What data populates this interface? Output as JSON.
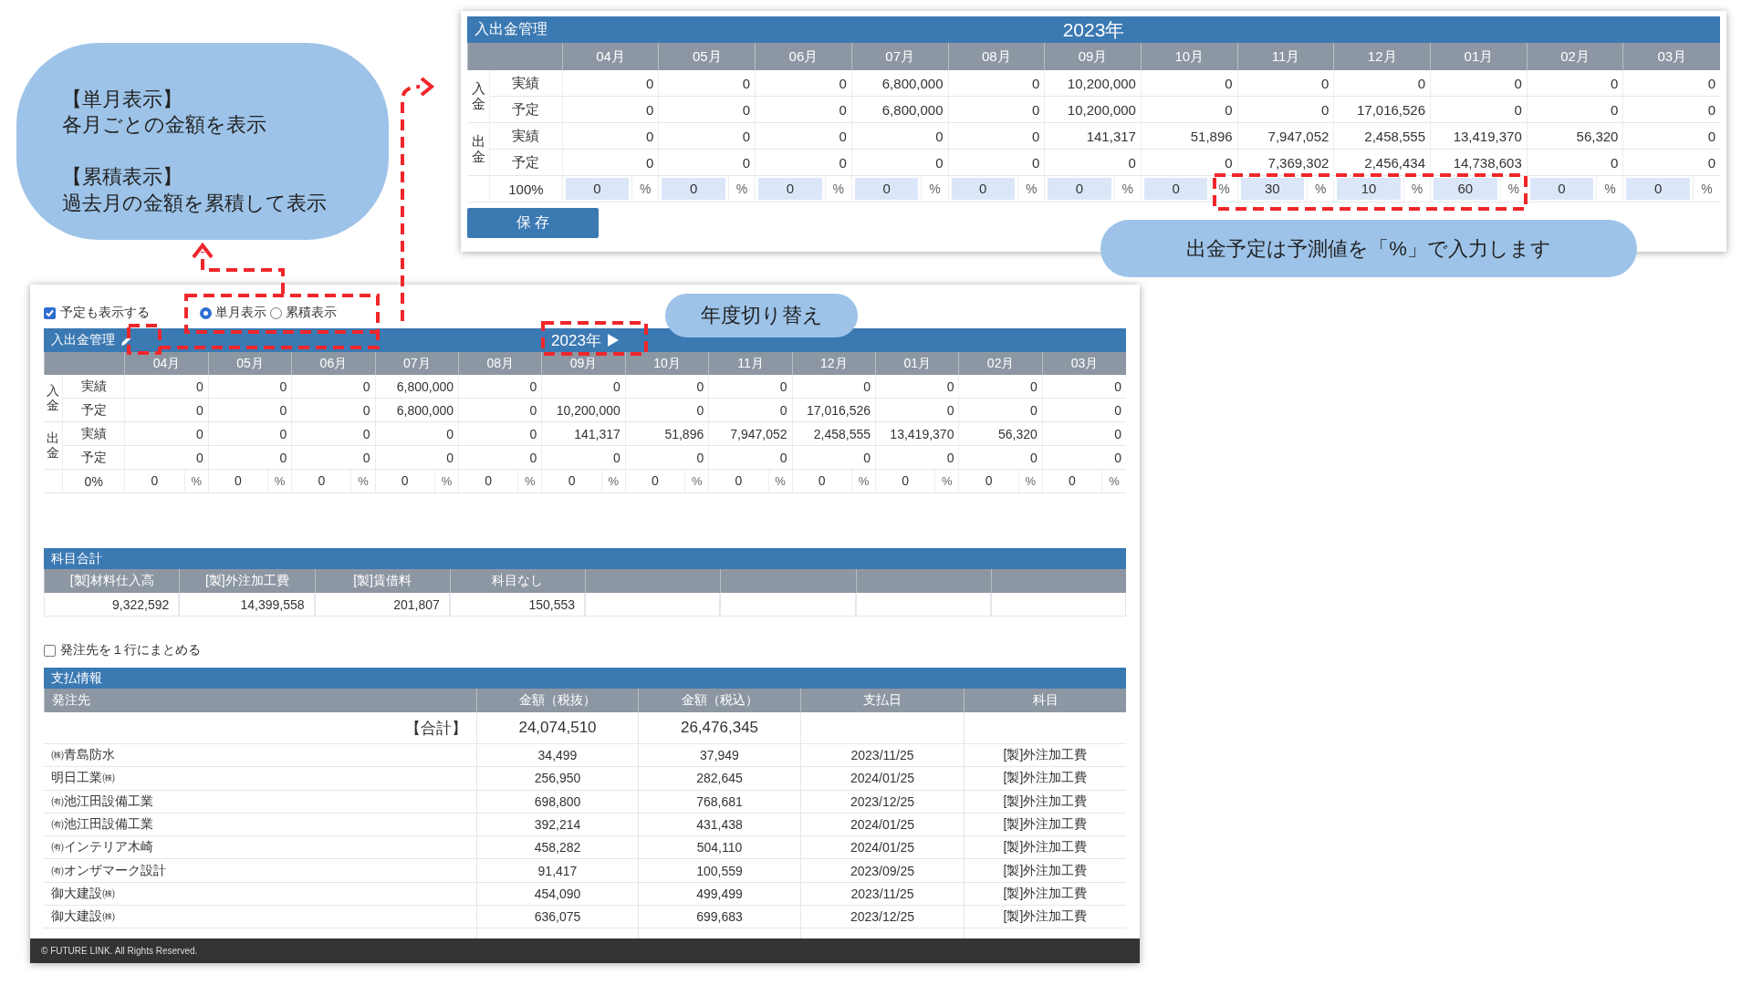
{
  "notes": [
    {
      "kind": "bubble",
      "lines": [
        "【単月表示】",
        "各月ごとの金額を表示",
        "【累積表示】",
        "過去月の金額を累積して表示"
      ]
    },
    {
      "kind": "pill",
      "lines": [
        "出金予定は予測値を「%」で入力します"
      ]
    },
    {
      "kind": "pill",
      "lines": [
        "年度切り替え"
      ]
    }
  ],
  "top_panel": {
    "title": "入出金管理",
    "year": "2023年",
    "months": [
      "04月",
      "05月",
      "06月",
      "07月",
      "08月",
      "09月",
      "10月",
      "11月",
      "12月",
      "01月",
      "02月",
      "03月"
    ],
    "groups": [
      {
        "label": "入金",
        "rows": [
          {
            "label": "実績",
            "values": [
              "0",
              "0",
              "0",
              "6,800,000",
              "0",
              "10,200,000",
              "0",
              "0",
              "0",
              "0",
              "0",
              "0"
            ]
          },
          {
            "label": "予定",
            "values": [
              "0",
              "0",
              "0",
              "6,800,000",
              "0",
              "10,200,000",
              "0",
              "0",
              "17,016,526",
              "0",
              "0",
              "0"
            ]
          }
        ]
      },
      {
        "label": "出金",
        "rows": [
          {
            "label": "実績",
            "values": [
              "0",
              "0",
              "0",
              "0",
              "0",
              "141,317",
              "51,896",
              "7,947,052",
              "2,458,555",
              "13,419,370",
              "56,320",
              "0"
            ]
          },
          {
            "label": "予定",
            "values": [
              "0",
              "0",
              "0",
              "0",
              "0",
              "0",
              "0",
              "7,369,302",
              "2,456,434",
              "14,738,603",
              "0",
              "0"
            ]
          }
        ]
      }
    ],
    "percent_row": {
      "label": "100%",
      "editable": true,
      "cells": [
        {
          "value": "0",
          "unit": "%"
        },
        {
          "value": "0",
          "unit": "%"
        },
        {
          "value": "0",
          "unit": "%"
        },
        {
          "value": "0",
          "unit": "%"
        },
        {
          "value": "0",
          "unit": "%"
        },
        {
          "value": "0",
          "unit": "%"
        },
        {
          "value": "0",
          "unit": "%"
        },
        {
          "value": "30",
          "unit": "%"
        },
        {
          "value": "10",
          "unit": "%"
        },
        {
          "value": "60",
          "unit": "%"
        },
        {
          "value": "0",
          "unit": "%"
        },
        {
          "value": "0",
          "unit": "%"
        }
      ]
    },
    "save_button": "保 存"
  },
  "bottom_panel": {
    "options": {
      "show_planned": {
        "label": "予定も表示する",
        "checked": true
      },
      "view_modes": [
        {
          "label": "単月表示",
          "selected": true
        },
        {
          "label": "累積表示",
          "selected": false
        }
      ]
    },
    "cashflow": {
      "title": "入出金管理",
      "year": "2023年",
      "edit_button": true,
      "next_year_button": true,
      "months": [
        "04月",
        "05月",
        "06月",
        "07月",
        "08月",
        "09月",
        "10月",
        "11月",
        "12月",
        "01月",
        "02月",
        "03月"
      ],
      "groups": [
        {
          "label": "入金",
          "rows": [
            {
              "label": "実績",
              "values": [
                "0",
                "0",
                "0",
                "6,800,000",
                "0",
                "0",
                "0",
                "0",
                "0",
                "0",
                "0",
                "0"
              ]
            },
            {
              "label": "予定",
              "values": [
                "0",
                "0",
                "0",
                "6,800,000",
                "0",
                "10,200,000",
                "0",
                "0",
                "17,016,526",
                "0",
                "0",
                "0"
              ]
            }
          ]
        },
        {
          "label": "出金",
          "rows": [
            {
              "label": "実績",
              "values": [
                "0",
                "0",
                "0",
                "0",
                "0",
                "141,317",
                "51,896",
                "7,947,052",
                "2,458,555",
                "13,419,370",
                "56,320",
                "0"
              ]
            },
            {
              "label": "予定",
              "values": [
                "0",
                "0",
                "0",
                "0",
                "0",
                "0",
                "0",
                "0",
                "0",
                "0",
                "0",
                "0"
              ]
            }
          ]
        }
      ],
      "percent_row": {
        "label": "0%",
        "editable": false,
        "cells": [
          {
            "value": "0",
            "unit": "%"
          },
          {
            "value": "0",
            "unit": "%"
          },
          {
            "value": "0",
            "unit": "%"
          },
          {
            "value": "0",
            "unit": "%"
          },
          {
            "value": "0",
            "unit": "%"
          },
          {
            "value": "0",
            "unit": "%"
          },
          {
            "value": "0",
            "unit": "%"
          },
          {
            "value": "0",
            "unit": "%"
          },
          {
            "value": "0",
            "unit": "%"
          },
          {
            "value": "0",
            "unit": "%"
          },
          {
            "value": "0",
            "unit": "%"
          },
          {
            "value": "0",
            "unit": "%"
          }
        ]
      }
    },
    "subjects": {
      "title": "科目合計",
      "columns": [
        "[製]材料仕入高",
        "[製]外注加工費",
        "[製]賃借料",
        "科目なし"
      ],
      "values": [
        "9,322,592",
        "14,399,558",
        "201,807",
        "150,553"
      ]
    },
    "merge_option": {
      "label": "発注先を１行にまとめる",
      "checked": false
    },
    "payments": {
      "title": "支払情報",
      "columns": [
        "発注先",
        "金額（税抜）",
        "金額（税込）",
        "支払日",
        "科目"
      ],
      "total": {
        "label": "【合計】",
        "excl": "24,074,510",
        "incl": "26,476,345"
      },
      "rows": [
        [
          "㈱青島防水",
          "34,499",
          "37,949",
          "2023/11/25",
          "[製]外注加工費"
        ],
        [
          "明日工業㈱",
          "256,950",
          "282,645",
          "2024/01/25",
          "[製]外注加工費"
        ],
        [
          "㈲池江田設備工業",
          "698,800",
          "768,681",
          "2023/12/25",
          "[製]外注加工費"
        ],
        [
          "㈲池江田設備工業",
          "392,214",
          "431,438",
          "2024/01/25",
          "[製]外注加工費"
        ],
        [
          "㈲インテリア木崎",
          "458,282",
          "504,110",
          "2024/01/25",
          "[製]外注加工費"
        ],
        [
          "㈲オンザマーク設計",
          "91,417",
          "100,559",
          "2023/09/25",
          "[製]外注加工費"
        ],
        [
          "御大建設㈱",
          "454,090",
          "499,499",
          "2023/11/25",
          "[製]外注加工費"
        ],
        [
          "御大建設㈱",
          "636,075",
          "699,683",
          "2023/12/25",
          "[製]外注加工費"
        ]
      ]
    },
    "footer": "© FUTURE LINK. All Rights Reserved."
  }
}
